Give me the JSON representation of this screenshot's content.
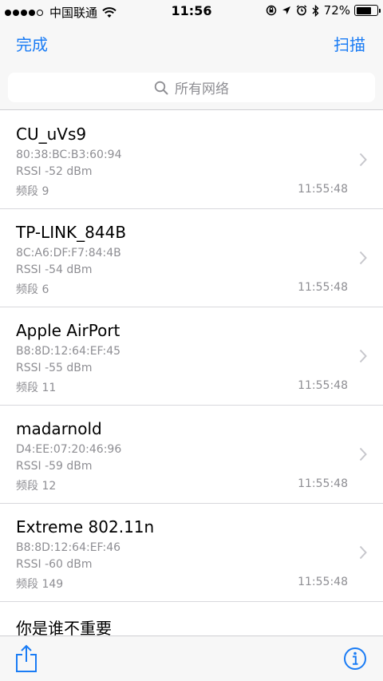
{
  "status": {
    "carrier": "中国联通",
    "time": "11:56",
    "battery": "72%",
    "battery_level": 0.72
  },
  "nav": {
    "done": "完成",
    "scan": "扫描"
  },
  "search": {
    "placeholder": "所有网络"
  },
  "networks": [
    {
      "ssid": "CU_uVs9",
      "mac": "80:38:BC:B3:60:94",
      "rssi": "RSSI -52 dBm",
      "band": "频段 9",
      "time": "11:55:48"
    },
    {
      "ssid": "TP-LINK_844B",
      "mac": "8C:A6:DF:F7:84:4B",
      "rssi": "RSSI -54 dBm",
      "band": "频段 6",
      "time": "11:55:48"
    },
    {
      "ssid": "Apple AirPort",
      "mac": "B8:8D:12:64:EF:45",
      "rssi": "RSSI -55 dBm",
      "band": "频段 11",
      "time": "11:55:48"
    },
    {
      "ssid": "madarnold",
      "mac": "D4:EE:07:20:46:96",
      "rssi": "RSSI -59 dBm",
      "band": "频段 12",
      "time": "11:55:48"
    },
    {
      "ssid": "Extreme 802.11n",
      "mac": "B8:8D:12:64:EF:46",
      "rssi": "RSSI -60 dBm",
      "band": "频段 149",
      "time": "11:55:48"
    },
    {
      "ssid": "你是谁不重要"
    }
  ],
  "colors": {
    "accent": "#1a7cf5",
    "secondary_text": "#8e8e93",
    "bar_background": "#f7f7f7"
  },
  "icons": {
    "search": "search-icon",
    "share": "share-icon",
    "info": "info-icon",
    "chevron": "chevron-right-icon"
  }
}
